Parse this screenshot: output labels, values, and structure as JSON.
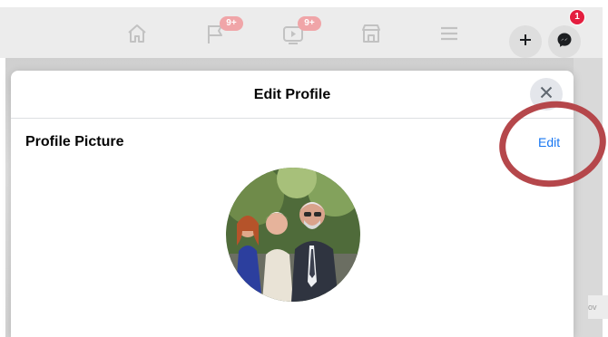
{
  "nav": {
    "items": [
      {
        "name": "home",
        "icon": "home-icon"
      },
      {
        "name": "pages",
        "icon": "flag-icon",
        "badge": "9+"
      },
      {
        "name": "watch",
        "icon": "video-icon",
        "badge": "9+"
      },
      {
        "name": "marketplace",
        "icon": "store-icon"
      },
      {
        "name": "menu",
        "icon": "hamburger-icon"
      }
    ],
    "create_icon": "plus-icon",
    "messenger_icon": "messenger-icon",
    "messenger_badge": "1"
  },
  "modal": {
    "title": "Edit Profile",
    "close_icon": "close-icon",
    "section_title": "Profile Picture",
    "edit_label": "Edit"
  },
  "backdrop_text": "ov",
  "colors": {
    "accent": "#1877f2",
    "badge_red": "#e41e3f",
    "annotation": "#b5474b"
  }
}
